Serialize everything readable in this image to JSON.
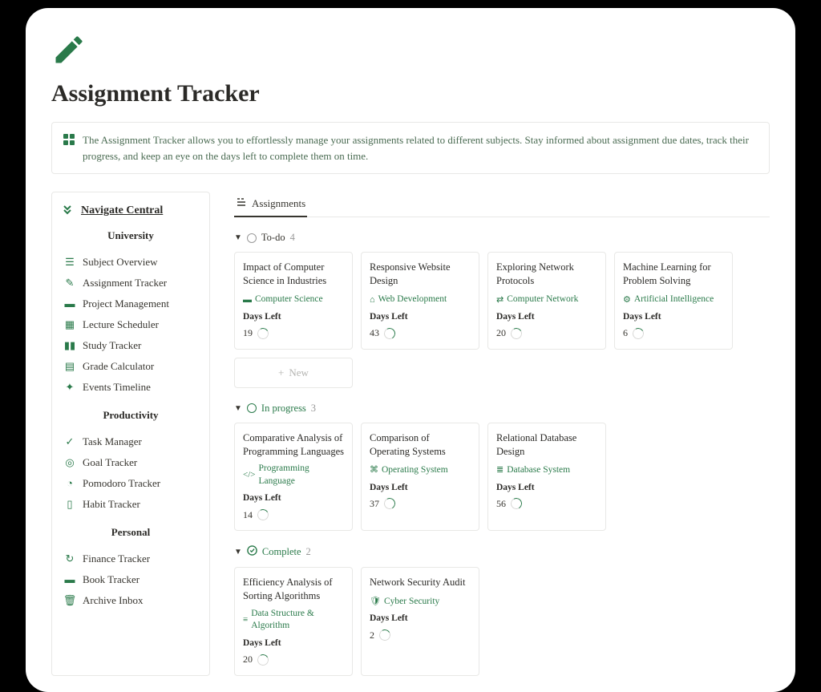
{
  "header": {
    "title": "Assignment Tracker",
    "description": "The Assignment Tracker allows you to effortlessly manage your assignments related to different subjects. Stay informed about assignment due dates, track their progress, and keep an eye on the days left to complete them on time."
  },
  "sidebar": {
    "title": "Navigate Central",
    "sections": [
      {
        "title": "University",
        "items": [
          {
            "icon": "☰",
            "label": "Subject Overview"
          },
          {
            "icon": "✎",
            "label": "Assignment Tracker"
          },
          {
            "icon": "▬",
            "label": "Project Management"
          },
          {
            "icon": "▦",
            "label": "Lecture Scheduler"
          },
          {
            "icon": "▮▮",
            "label": "Study Tracker"
          },
          {
            "icon": "▤",
            "label": "Grade Calculator"
          },
          {
            "icon": "✦",
            "label": "Events Timeline"
          }
        ]
      },
      {
        "title": "Productivity",
        "items": [
          {
            "icon": "✓",
            "label": "Task Manager"
          },
          {
            "icon": "◎",
            "label": "Goal Tracker"
          },
          {
            "icon": "◔",
            "label": "Pomodoro Tracker"
          },
          {
            "icon": "▯",
            "label": "Habit Tracker"
          }
        ]
      },
      {
        "title": "Personal",
        "items": [
          {
            "icon": "↻",
            "label": "Finance Tracker"
          },
          {
            "icon": "▬",
            "label": "Book Tracker"
          },
          {
            "icon": "🗑",
            "label": "Archive Inbox"
          }
        ]
      }
    ]
  },
  "content": {
    "tab_label": "Assignments",
    "days_left_label": "Days Left",
    "new_button": "New",
    "groups": [
      {
        "status": "todo",
        "label": "To-do",
        "count": "4",
        "cards": [
          {
            "title": "Impact of Computer Science in Industries",
            "subject": "Computer Science",
            "days": "19"
          },
          {
            "title": "Responsive Website Design",
            "subject": "Web Development",
            "days": "43"
          },
          {
            "title": "Exploring Network Protocols",
            "subject": "Computer Network",
            "days": "20"
          },
          {
            "title": "Machine Learning for Problem Solving",
            "subject": "Artificial Intelligence",
            "days": "6"
          }
        ]
      },
      {
        "status": "inprogress",
        "label": "In progress",
        "count": "3",
        "cards": [
          {
            "title": "Comparative Analysis of Programming Languages",
            "subject": "Programming Language",
            "days": "14"
          },
          {
            "title": "Comparison of Operating Systems",
            "subject": "Operating System",
            "days": "37"
          },
          {
            "title": "Relational Database Design",
            "subject": "Database System",
            "days": "56"
          }
        ]
      },
      {
        "status": "complete",
        "label": "Complete",
        "count": "2",
        "cards": [
          {
            "title": "Efficiency Analysis of Sorting Algorithms",
            "subject": "Data Structure & Algorithm",
            "days": "20"
          },
          {
            "title": "Network Security Audit",
            "subject": "Cyber Security",
            "days": "2"
          }
        ]
      }
    ]
  }
}
